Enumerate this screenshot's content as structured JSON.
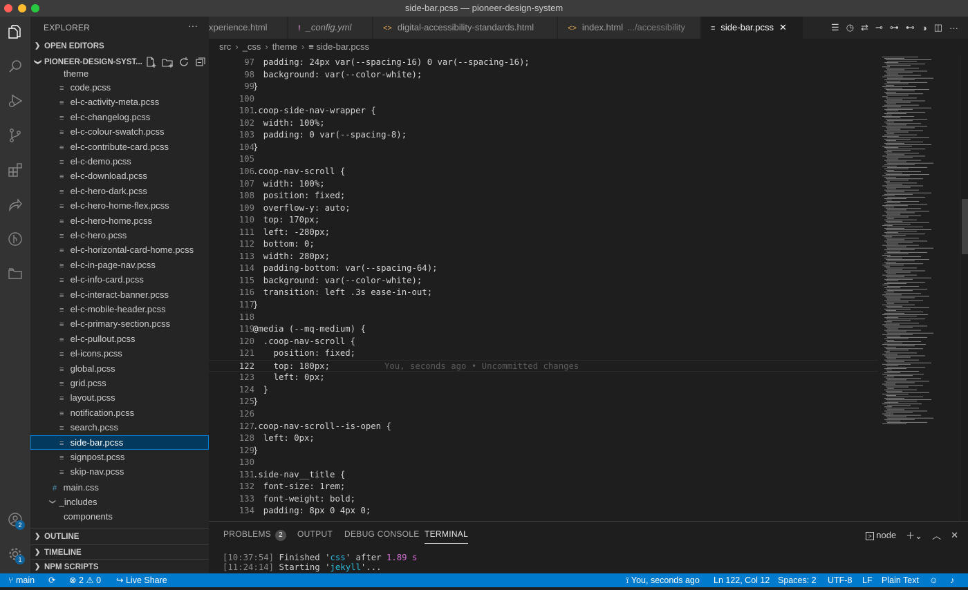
{
  "window": {
    "title": "side-bar.pcss — pioneer-design-system"
  },
  "activity_bar": {
    "accounts_badge": "2",
    "manage_badge": "1"
  },
  "sidebar": {
    "title": "EXPLORER",
    "open_editors": "OPEN EDITORS",
    "project": "PIONEER-DESIGN-SYST...",
    "folder_theme": "theme",
    "files": [
      "code.pcss",
      "el-c-activity-meta.pcss",
      "el-c-changelog.pcss",
      "el-c-colour-swatch.pcss",
      "el-c-contribute-card.pcss",
      "el-c-demo.pcss",
      "el-c-download.pcss",
      "el-c-hero-dark.pcss",
      "el-c-hero-home-flex.pcss",
      "el-c-hero-home.pcss",
      "el-c-hero.pcss",
      "el-c-horizontal-card-home.pcss",
      "el-c-in-page-nav.pcss",
      "el-c-info-card.pcss",
      "el-c-interact-banner.pcss",
      "el-c-mobile-header.pcss",
      "el-c-primary-section.pcss",
      "el-c-pullout.pcss",
      "el-icons.pcss",
      "global.pcss",
      "grid.pcss",
      "layout.pcss",
      "notification.pcss",
      "search.pcss",
      "side-bar.pcss",
      "signpost.pcss",
      "skip-nav.pcss"
    ],
    "main_css": "main.css",
    "folder_includes": "_includes",
    "folder_components": "components",
    "outline": "OUTLINE",
    "timeline": "TIMELINE",
    "npm_scripts": "NPM SCRIPTS"
  },
  "tabs": [
    {
      "label": "xperience.html",
      "icon": "html-icon"
    },
    {
      "label": "_config.yml",
      "icon": "yaml-icon"
    },
    {
      "label": "digital-accessibility-standards.html",
      "icon": "html-icon"
    },
    {
      "label": "index.html",
      "hint": ".../accessibility",
      "icon": "html-icon"
    },
    {
      "label": "side-bar.pcss",
      "icon": "css-icon"
    }
  ],
  "breadcrumb": [
    "src",
    "_css",
    "theme",
    "side-bar.pcss"
  ],
  "editor": {
    "lines": [
      {
        "n": "97",
        "t": "  padding: 24px var(--spacing-16) 0 var(--spacing-16);"
      },
      {
        "n": "98",
        "t": "  background: var(--color-white);"
      },
      {
        "n": "99",
        "t": "}"
      },
      {
        "n": "100",
        "t": ""
      },
      {
        "n": "101",
        "t": ".coop-side-nav-wrapper {"
      },
      {
        "n": "102",
        "t": "  width: 100%;"
      },
      {
        "n": "103",
        "t": "  padding: 0 var(--spacing-8);"
      },
      {
        "n": "104",
        "t": "}"
      },
      {
        "n": "105",
        "t": ""
      },
      {
        "n": "106",
        "t": ".coop-nav-scroll {"
      },
      {
        "n": "107",
        "t": "  width: 100%;"
      },
      {
        "n": "108",
        "t": "  position: fixed;"
      },
      {
        "n": "109",
        "t": "  overflow-y: auto;"
      },
      {
        "n": "110",
        "t": "  top: 170px;"
      },
      {
        "n": "111",
        "t": "  left: -280px;"
      },
      {
        "n": "112",
        "t": "  bottom: 0;"
      },
      {
        "n": "113",
        "t": "  width: 280px;"
      },
      {
        "n": "114",
        "t": "  padding-bottom: var(--spacing-64);"
      },
      {
        "n": "115",
        "t": "  background: var(--color-white);"
      },
      {
        "n": "116",
        "t": "  transition: left .3s ease-in-out;"
      },
      {
        "n": "117",
        "t": "}"
      },
      {
        "n": "118",
        "t": ""
      },
      {
        "n": "119",
        "t": "@media (--mq-medium) {"
      },
      {
        "n": "120",
        "t": "  .coop-nav-scroll {"
      },
      {
        "n": "121",
        "t": "    position: fixed;"
      },
      {
        "n": "122",
        "t": "    top: 180px;"
      },
      {
        "n": "123",
        "t": "    left: 0px;"
      },
      {
        "n": "124",
        "t": "  }"
      },
      {
        "n": "125",
        "t": "}"
      },
      {
        "n": "126",
        "t": ""
      },
      {
        "n": "127",
        "t": ".coop-nav-scroll--is-open {"
      },
      {
        "n": "128",
        "t": "  left: 0px;"
      },
      {
        "n": "129",
        "t": "}"
      },
      {
        "n": "130",
        "t": ""
      },
      {
        "n": "131",
        "t": ".side-nav__title {"
      },
      {
        "n": "132",
        "t": "  font-size: 1rem;"
      },
      {
        "n": "133",
        "t": "  font-weight: bold;"
      },
      {
        "n": "134",
        "t": "  padding: 8px 0 4px 0;"
      }
    ],
    "blame": "You, seconds ago • Uncommitted changes"
  },
  "panel": {
    "tabs": [
      "PROBLEMS",
      "OUTPUT",
      "DEBUG CONSOLE",
      "TERMINAL"
    ],
    "problems_count": "2",
    "terminal_name": "node",
    "terminal_lines": [
      {
        "time": "[10:37:54]",
        "text": " Finished '",
        "task": "css",
        "after": "' after ",
        "dur": "1.89 s"
      },
      {
        "time": "[11:24:14]",
        "text": " Starting '",
        "task": "jekyll",
        "after": "'...",
        "dur": ""
      }
    ]
  },
  "status": {
    "branch": "main",
    "errors": "2",
    "warnings": "0",
    "live_share": "Live Share",
    "blame": "You, seconds ago",
    "position": "Ln 122, Col 12",
    "spaces": "Spaces: 2",
    "encoding": "UTF-8",
    "eol": "LF",
    "language": "Plain Text"
  }
}
